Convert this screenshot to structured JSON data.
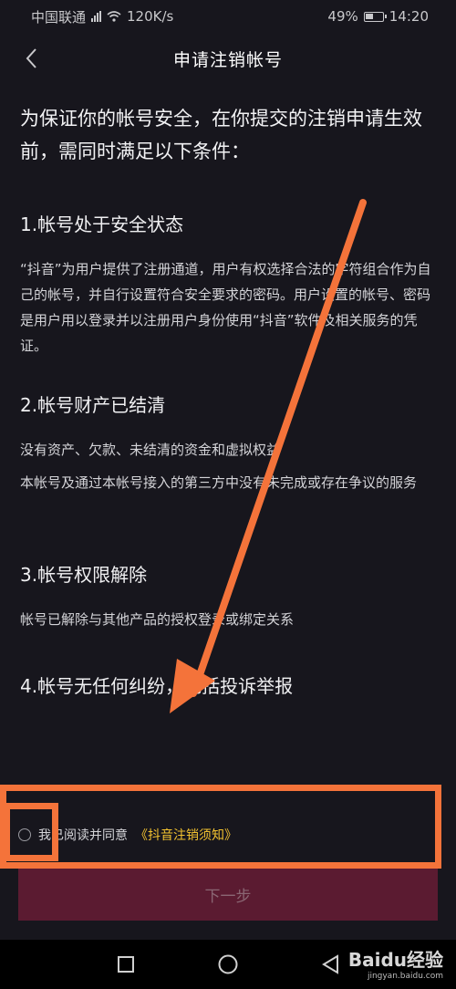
{
  "status_bar": {
    "carrier": "中国联通",
    "network_speed": "120K/s",
    "battery_percent": "49%",
    "battery_level": 0.49,
    "time": "14:20"
  },
  "header": {
    "title": "申请注销帐号"
  },
  "intro": "为保证你的帐号安全，在你提交的注销申请生效前，需同时满足以下条件：",
  "sections": [
    {
      "title": "1.帐号处于安全状态",
      "paragraphs": [
        "“抖音”为用户提供了注册通道，用户有权选择合法的字符组合作为自己的帐号，并自行设置符合安全要求的密码。用户设置的帐号、密码是用户用以登录并以注册用户身份使用“抖音”软件及相关服务的凭证。"
      ]
    },
    {
      "title": "2.帐号财产已结清",
      "paragraphs": [
        "没有资产、欠款、未结清的资金和虚拟权益",
        "本帐号及通过本帐号接入的第三方中没有未完成或存在争议的服务"
      ]
    },
    {
      "title": "3.帐号权限解除",
      "paragraphs": [
        "帐号已解除与其他产品的授权登录或绑定关系"
      ]
    },
    {
      "title": "4.帐号无任何纠纷，包括投诉举报",
      "paragraphs": []
    }
  ],
  "agreement": {
    "prefix": "我已阅读并同意",
    "link": "《抖音注销须知》",
    "checked": false
  },
  "submit_label": "下一步",
  "watermark": {
    "brand": "Baidu经验",
    "url": "jingyan.baidu.com"
  },
  "colors": {
    "background": "#17161d",
    "accent": "#f2c230",
    "button_disabled": "#5b1b31",
    "annotation": "#f4733a"
  }
}
